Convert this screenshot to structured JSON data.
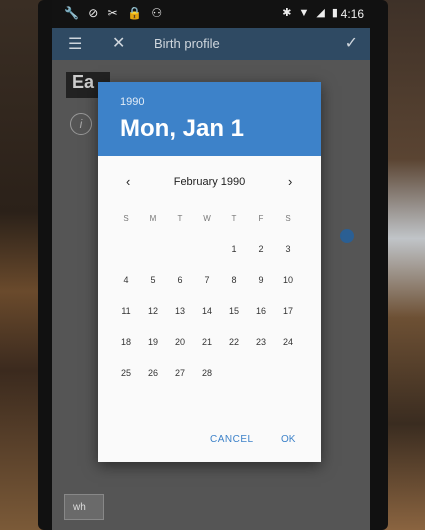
{
  "status_bar": {
    "time": "4:16"
  },
  "app_bar": {
    "title": "Birth profile"
  },
  "background": {
    "name_field_partial": "Ea",
    "info_glyph": "i",
    "input_partial": "wh"
  },
  "date_picker": {
    "header_year": "1990",
    "header_date": "Mon, Jan 1",
    "month_label": "February 1990",
    "prev_glyph": "‹",
    "next_glyph": "›",
    "weekdays": [
      "S",
      "M",
      "T",
      "W",
      "T",
      "F",
      "S"
    ],
    "weeks": [
      [
        "",
        "",
        "",
        "",
        "1",
        "2",
        "3"
      ],
      [
        "4",
        "5",
        "6",
        "7",
        "8",
        "9",
        "10"
      ],
      [
        "11",
        "12",
        "13",
        "14",
        "15",
        "16",
        "17"
      ],
      [
        "18",
        "19",
        "20",
        "21",
        "22",
        "23",
        "24"
      ],
      [
        "25",
        "26",
        "27",
        "28",
        "",
        "",
        ""
      ]
    ],
    "cancel_label": "CANCEL",
    "ok_label": "OK"
  },
  "colors": {
    "header_blue": "#3d82c9",
    "app_bar": "#2f4a63",
    "dialog_bg": "#fafafa"
  }
}
